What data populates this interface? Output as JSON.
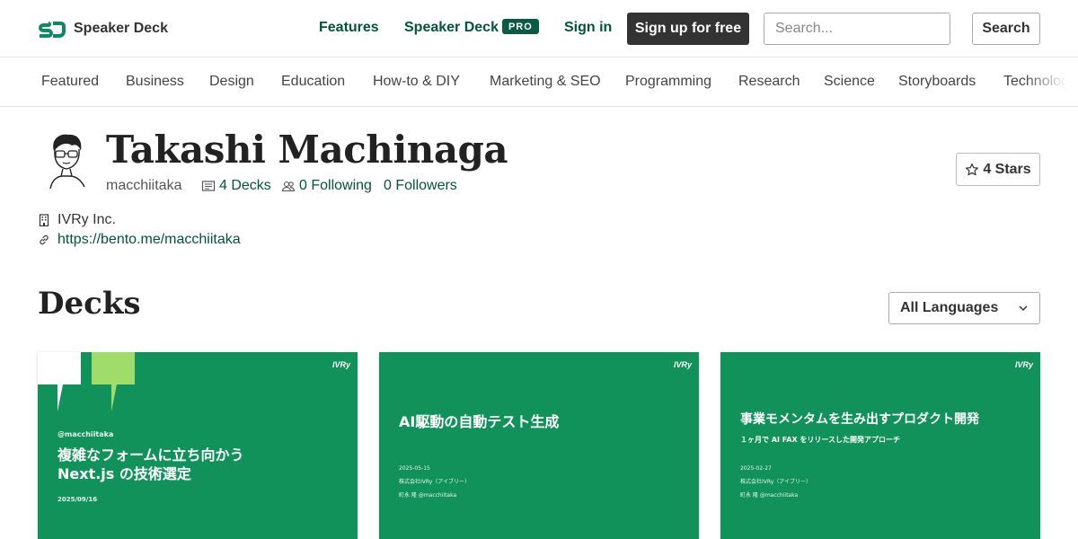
{
  "header": {
    "logo_text": "Speaker Deck",
    "nav_features": "Features",
    "nav_pro": "Speaker Deck",
    "pro_badge": "PRO",
    "sign_in": "Sign in",
    "sign_up": "Sign up for free",
    "search_placeholder": "Search...",
    "search_button": "Search"
  },
  "categories": [
    "Featured",
    "Business",
    "Design",
    "Education",
    "How-to & DIY",
    "Marketing & SEO",
    "Programming",
    "Research",
    "Science",
    "Storyboards",
    "Technology"
  ],
  "profile": {
    "name": "Takashi Machinaga",
    "username": "macchiitaka",
    "decks": "4 Decks",
    "following": "0 Following",
    "followers": "0 Followers",
    "stars": "4 Stars",
    "company": "IVRy Inc.",
    "website": "https://bento.me/macchiitaka"
  },
  "decks_section": {
    "title": "Decks",
    "language_select": "All Languages"
  },
  "cards": [
    {
      "brand": "IVRy",
      "author": "@macchiitaka",
      "title_line1": "複雑なフォームに立ち向かう",
      "title_line2": "Next.js の技術選定",
      "date": "2025/09/16"
    },
    {
      "brand": "IVRy",
      "title": "AI駆動の自動テスト生成",
      "date": "2025-05-15",
      "company": "株式会社IVRy（アイブリー）",
      "author": "町永 隆 @macchiitaka"
    },
    {
      "brand": "IVRy",
      "title": "事業モメンタムを生み出すプロダクト開発",
      "subtitle": "１ヶ月で AI FAX をリリースした開発アプローチ",
      "date": "2025-02-27",
      "company": "株式会社IVRy（アイブリー）",
      "author": "町永 隆 @macchiitaka"
    }
  ],
  "colors": {
    "brand_green": "#00553a",
    "card_green": "#11925a",
    "accent_lime": "#9fdc6a"
  }
}
